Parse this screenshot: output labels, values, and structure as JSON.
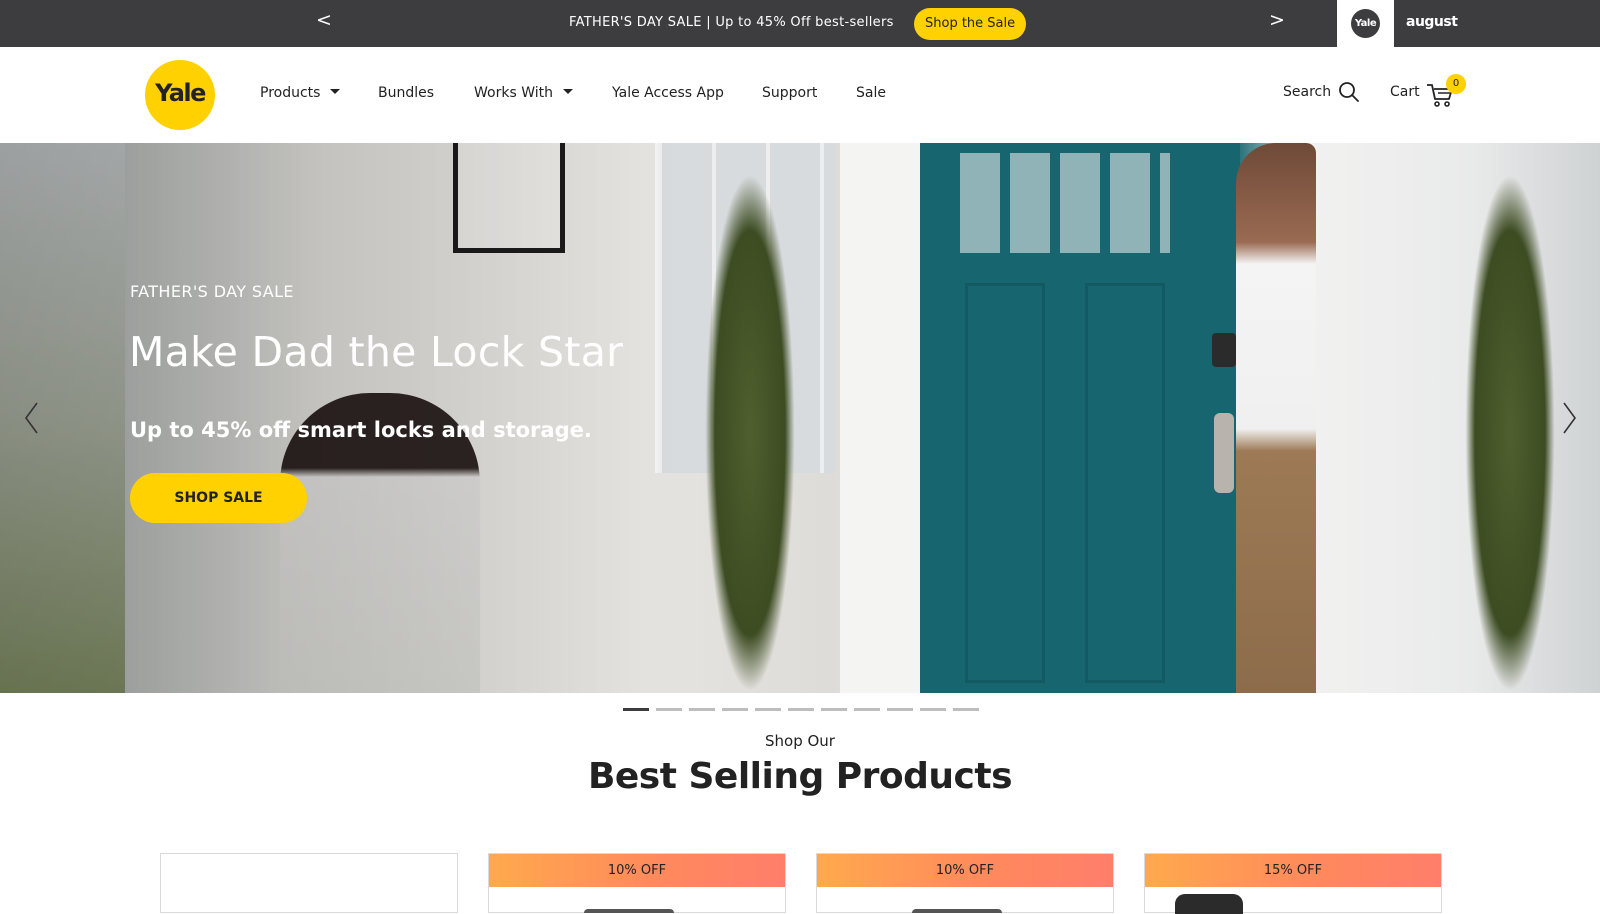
{
  "topbar": {
    "prev_arrow": "<",
    "next_arrow": ">",
    "promo_text": "FATHER'S DAY SALE | Up to 45% Off best-sellers",
    "promo_button": "Shop the Sale",
    "brand_yale": "Yale",
    "brand_august": "august"
  },
  "header": {
    "logo_text": "Yale",
    "nav": [
      {
        "label": "Products",
        "has_dropdown": true
      },
      {
        "label": "Bundles",
        "has_dropdown": false
      },
      {
        "label": "Works With",
        "has_dropdown": true
      },
      {
        "label": "Yale Access App",
        "has_dropdown": false
      },
      {
        "label": "Support",
        "has_dropdown": false
      },
      {
        "label": "Sale",
        "has_dropdown": false
      }
    ],
    "search_label": "Search",
    "cart_label": "Cart",
    "cart_count": "0"
  },
  "hero": {
    "eyebrow": "FATHER'S DAY SALE",
    "title": "Make Dad the Lock Star",
    "subtitle": "Up to 45% off smart locks and storage.",
    "button": "SHOP SALE",
    "slide_count": 11,
    "active_slide": 1
  },
  "best_sellers": {
    "eyebrow": "Shop Our",
    "title": "Best Selling Products",
    "cards": [
      {
        "badge": ""
      },
      {
        "badge": "10% OFF"
      },
      {
        "badge": "10% OFF"
      },
      {
        "badge": "15% OFF"
      }
    ]
  },
  "colors": {
    "brand_yellow": "#ffd100",
    "topbar_bg": "#3d3d3f",
    "badge_gradient_start": "#ffa94d",
    "badge_gradient_end": "#ff7e6b"
  }
}
